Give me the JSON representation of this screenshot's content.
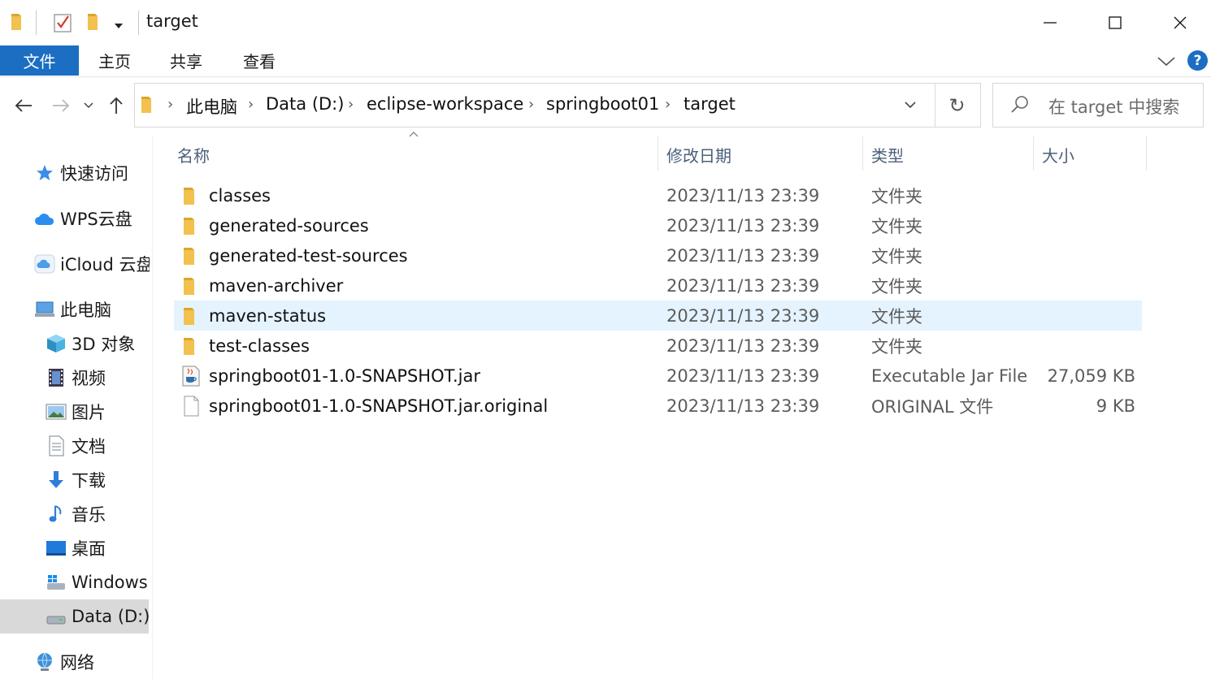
{
  "window": {
    "title": "target",
    "controls": {
      "minimize": "—",
      "maximize": "☐",
      "close": "✕"
    }
  },
  "ribbon": {
    "tabs": [
      {
        "label": "文件"
      },
      {
        "label": "主页"
      },
      {
        "label": "共享"
      },
      {
        "label": "查看"
      }
    ],
    "help": "?"
  },
  "address": {
    "crumbs": [
      "此电脑",
      "Data (D:)",
      "eclipse-workspace",
      "springboot01",
      "target"
    ],
    "separator": "›",
    "search_placeholder": "在 target 中搜索"
  },
  "nav": {
    "back": "←",
    "forward": "→",
    "recent": "⌄",
    "up": "↑",
    "refresh": "↻"
  },
  "sidebar": {
    "items": [
      {
        "label": "快速访问",
        "icon": "star-icon"
      },
      {
        "label": "WPS云盘",
        "icon": "cloud-icon"
      },
      {
        "label": "iCloud 云盘",
        "icon": "icloud-icon"
      },
      {
        "label": "此电脑",
        "icon": "computer-icon"
      },
      {
        "label": "3D 对象",
        "icon": "cube-icon"
      },
      {
        "label": "视频",
        "icon": "film-icon"
      },
      {
        "label": "图片",
        "icon": "picture-icon"
      },
      {
        "label": "文档",
        "icon": "document-icon"
      },
      {
        "label": "下载",
        "icon": "download-icon"
      },
      {
        "label": "音乐",
        "icon": "music-icon"
      },
      {
        "label": "桌面",
        "icon": "desktop-icon"
      },
      {
        "label": "Windows",
        "icon": "windows-drive-icon"
      },
      {
        "label": "Data (D:)",
        "icon": "drive-icon"
      },
      {
        "label": "网络",
        "icon": "network-icon"
      }
    ],
    "selected": "Data (D:)"
  },
  "columns": {
    "name": "名称",
    "date": "修改日期",
    "type": "类型",
    "size": "大小"
  },
  "files": [
    {
      "name": "classes",
      "date": "2023/11/13 23:39",
      "type": "文件夹",
      "size": "",
      "icon": "folder-icon"
    },
    {
      "name": "generated-sources",
      "date": "2023/11/13 23:39",
      "type": "文件夹",
      "size": "",
      "icon": "folder-icon"
    },
    {
      "name": "generated-test-sources",
      "date": "2023/11/13 23:39",
      "type": "文件夹",
      "size": "",
      "icon": "folder-icon"
    },
    {
      "name": "maven-archiver",
      "date": "2023/11/13 23:39",
      "type": "文件夹",
      "size": "",
      "icon": "folder-icon"
    },
    {
      "name": "maven-status",
      "date": "2023/11/13 23:39",
      "type": "文件夹",
      "size": "",
      "icon": "folder-icon"
    },
    {
      "name": "test-classes",
      "date": "2023/11/13 23:39",
      "type": "文件夹",
      "size": "",
      "icon": "folder-icon"
    },
    {
      "name": "springboot01-1.0-SNAPSHOT.jar",
      "date": "2023/11/13 23:39",
      "type": "Executable Jar File",
      "size": "27,059 KB",
      "icon": "java-jar-icon"
    },
    {
      "name": "springboot01-1.0-SNAPSHOT.jar.original",
      "date": "2023/11/13 23:39",
      "type": "ORIGINAL 文件",
      "size": "9 KB",
      "icon": "file-icon"
    }
  ],
  "highlighted_row": "maven-status",
  "colors": {
    "accent": "#1b6ec2",
    "folder": "#f2c14e",
    "hover_row": "#e5f3ff",
    "sidebar_selected": "#d9d9d9"
  }
}
